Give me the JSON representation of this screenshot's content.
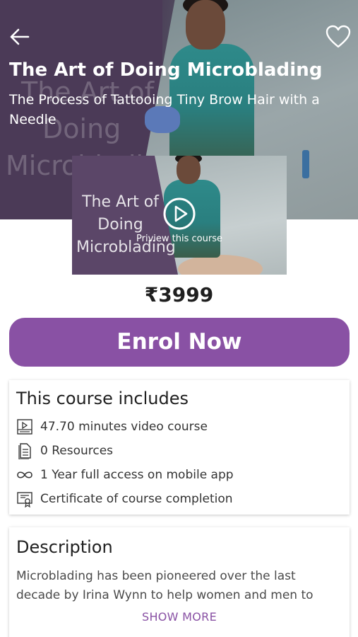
{
  "course": {
    "title": "The Art of Doing Microblading",
    "subtitle": "The Process of Tattooing Tiny Brow Hair with a Needle",
    "thumbnail_text": [
      "The Art of",
      "Doing",
      "Microblading"
    ],
    "preview_label": "Priview this course",
    "price": "₹3999",
    "enrol_label": "Enrol Now"
  },
  "header": {
    "back_icon": "arrow-left-icon",
    "favorite_icon": "heart-outline-icon"
  },
  "includes": {
    "heading": "This course includes",
    "items": [
      {
        "icon": "video-icon",
        "label": "47.70 minutes video course"
      },
      {
        "icon": "document-icon",
        "label": "0 Resources"
      },
      {
        "icon": "infinity-icon",
        "label": "1 Year full access on mobile app"
      },
      {
        "icon": "certificate-icon",
        "label": "Certificate of course completion"
      }
    ]
  },
  "description": {
    "heading": "Description",
    "text": "Microblading has been pioneered over the last decade by Irina Wynn to help women and men to",
    "show_more": "SHOW MORE"
  },
  "colors": {
    "accent": "#8951a4",
    "hero_purple": "#4b3a57",
    "text_dark": "#1f1f1f"
  }
}
